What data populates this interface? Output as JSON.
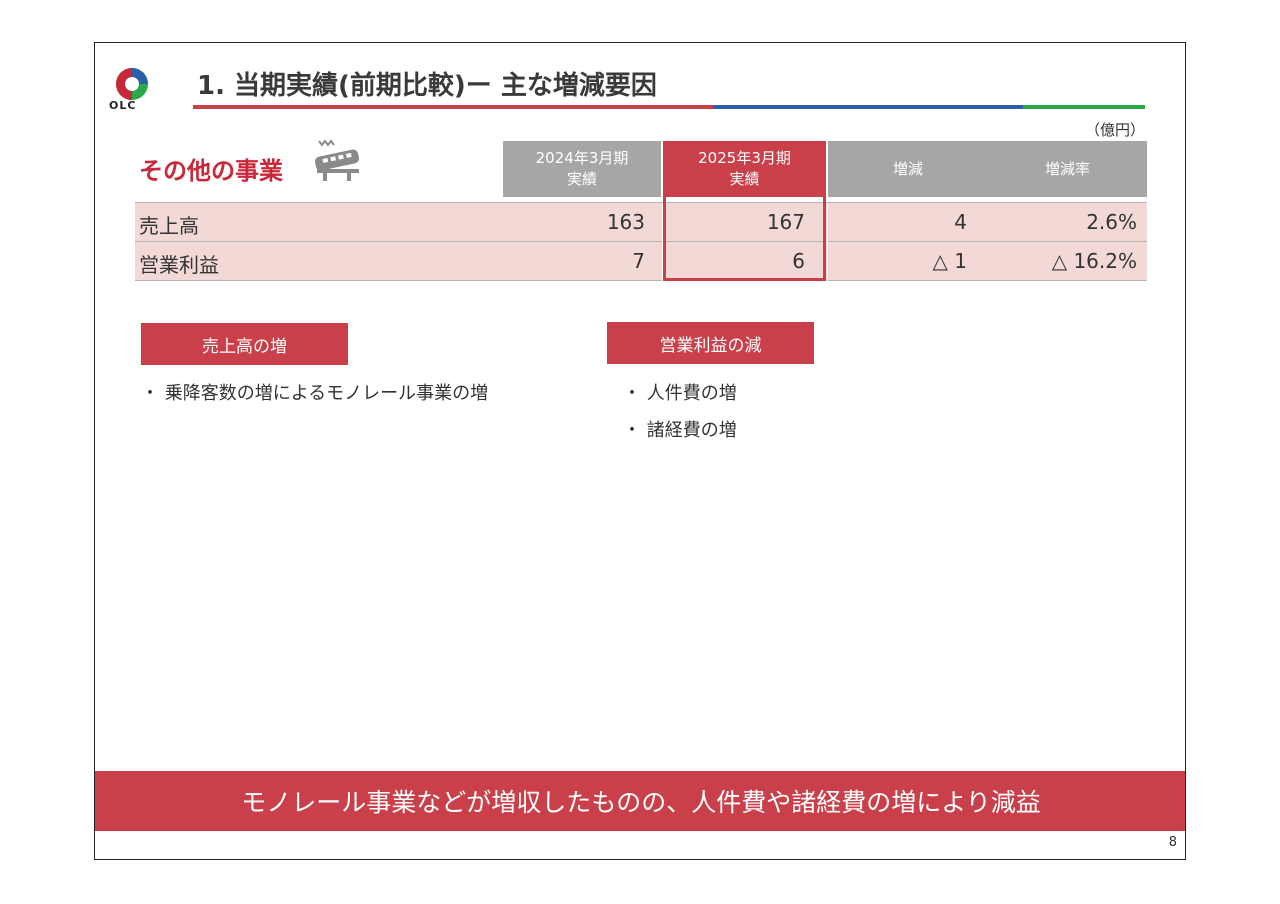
{
  "logo": {
    "text": "OLC"
  },
  "title": "1. 当期実績(前期比較)ー 主な増減要因",
  "unit": "（億円）",
  "segment": {
    "name": "その他の事業",
    "icon": "monorail-icon"
  },
  "table": {
    "headers": [
      "2024年3月期\n実績",
      "2025年3月期\n実績",
      "増減",
      "増減率"
    ],
    "rows": [
      {
        "label": "売上高",
        "prev": "163",
        "curr": "167",
        "diff": "4",
        "rate": "2.6%"
      },
      {
        "label": "営業利益",
        "prev": "7",
        "curr": "6",
        "diff": "△ 1",
        "rate": "△ 16.2%"
      }
    ]
  },
  "factors": {
    "sales_increase": {
      "label": "売上高の増",
      "items": [
        "・ 乗降客数の増によるモノレール事業の増"
      ]
    },
    "profit_decrease": {
      "label": "営業利益の減",
      "items": [
        "・ 人件費の増",
        "・ 諸経費の増"
      ]
    }
  },
  "summary": "モノレール事業などが増収したものの、人件費や諸経費の増により減益",
  "page_number": "8",
  "colors": {
    "accent_red": "#c9404a",
    "blue": "#2b5fa7",
    "green": "#2aa84a",
    "row_bg": "#f2d9d6",
    "header_gray": "#a6a6a6"
  }
}
